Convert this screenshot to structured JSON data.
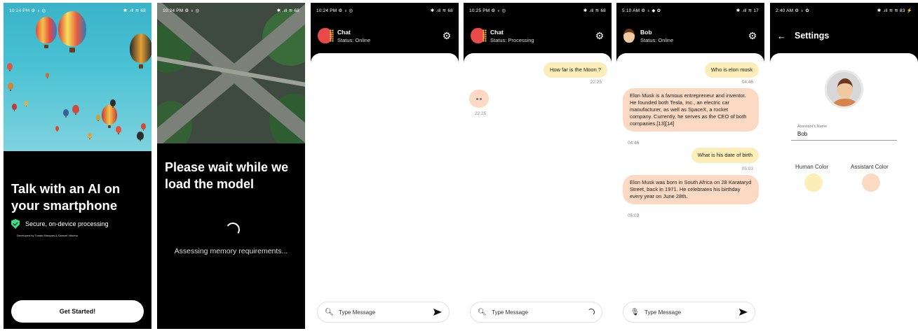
{
  "screens": {
    "welcome": {
      "status": {
        "time": "10:24 PM ⚙ ♁ ◎",
        "icons": "✱ .ıll ≋ 68"
      },
      "title": "Talk with an AI on your smartphone",
      "secure_label": "Secure, on-device processing",
      "developer_credit": "Developed by Tomás Marques & Samuel Vitorino",
      "button_label": "Get Started!",
      "colors": {
        "accent": "#3ddc84"
      }
    },
    "loading": {
      "status": {
        "time": "10:24 PM ⚙ ♁ ◎",
        "icons": "✱ .ıll ≋ 68"
      },
      "title": "Please wait while we load the model",
      "progress_text": "Assessing memory requirements..."
    },
    "chat_empty": {
      "status": {
        "time": "10:24 PM ⚙ ♁ ◎",
        "icons": "✱ .ıll ≋ 68"
      },
      "assistant_name": "Chat",
      "assistant_status": "Status: Online",
      "input_placeholder": "Type Message"
    },
    "chat_processing": {
      "status": {
        "time": "10:25 PM ⚙ ♁ ◎",
        "icons": "✱ .ıll ≋ 68"
      },
      "assistant_name": "Chat",
      "assistant_status": "Status: Processing",
      "messages": [
        {
          "sender": "human",
          "text": "How far is the Moon ?",
          "time": "22:25"
        },
        {
          "sender": "assistant",
          "text": "••",
          "time": "22:25"
        }
      ],
      "input_placeholder": "Type Message"
    },
    "chat_bob": {
      "status": {
        "time": "5:10 AM ⚙ ♁ ◆ ✿",
        "icons": "✱ .ıll ≋ 17"
      },
      "assistant_name": "Bob",
      "assistant_status": "Status: Online",
      "messages": [
        {
          "sender": "human",
          "text": "Who is elon musk",
          "time": "04:46"
        },
        {
          "sender": "assistant",
          "text": " Elon Musk is a famous entrepreneur and inventor. He founded both Tesla, Inc., an electric car manufacturer, as well as SpaceX, a rocket company. Currently, he serves as the CEO of both companies.[13][14]",
          "time": "04:46"
        },
        {
          "sender": "human",
          "text": "What is his date of birth",
          "time": "05:03"
        },
        {
          "sender": "assistant",
          "text": " Elon Musk was born in South Africa on 28 Karataryd Street, back in 1971. He celebrates his birthday every year on June 28th.",
          "time": "05:03"
        }
      ],
      "input_placeholder": "Type Message"
    },
    "settings": {
      "status": {
        "time": "2:40 AM ⚙ ♁ ✿",
        "icons": "✱ .ıll ≋ ≋ 83 ⚡"
      },
      "title": "Settings",
      "assistant_name_label": "Assistant's Name",
      "assistant_name_value": "Bob",
      "human_color_label": "Human Color",
      "assistant_color_label": "Assistant Color",
      "colors": {
        "human": "#fbeeb8",
        "assistant": "#fcd9c2"
      }
    }
  }
}
